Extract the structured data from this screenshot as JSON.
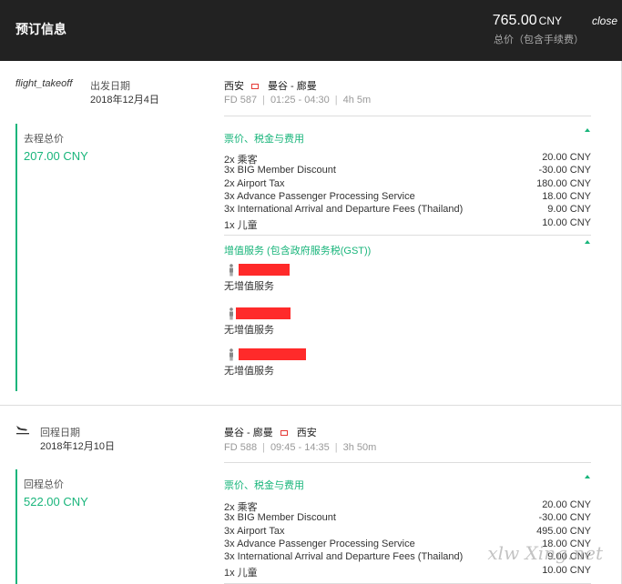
{
  "header": {
    "title": "预订信息",
    "total_amount": "765.00",
    "total_currency": "CNY",
    "close_label": "close",
    "total_note": "总价（包含手续费）"
  },
  "outbound": {
    "icon_text": "flight_takeoff",
    "label": "出发日期",
    "date": "2018年12月4日",
    "route_from": "西安",
    "route_to": "曼谷 - 廊曼",
    "flight_no": "FD 587",
    "time": "01:25 - 04:30",
    "duration": "4h 5m",
    "total_label": "去程总价",
    "total_amount": "207.00 CNY",
    "fees_title": "票价、税金与费用",
    "fees": [
      {
        "desc": "2x 乘客",
        "value": "20.00 CNY"
      },
      {
        "desc": "3x BIG Member Discount",
        "value": "-30.00 CNY"
      },
      {
        "desc": "2x Airport Tax",
        "value": "180.00 CNY"
      },
      {
        "desc": "3x Advance Passenger Processing Service",
        "value": "18.00 CNY"
      },
      {
        "desc": "3x International Arrival and Departure Fees (Thailand)",
        "value": "9.00 CNY"
      },
      {
        "desc": "1x 儿童",
        "value": "10.00 CNY"
      }
    ],
    "services_title": "增值服务 (包含政府服务税(GST))",
    "passengers": [
      {
        "service": "无增值服务"
      },
      {
        "service": "无增值服务"
      },
      {
        "service": "无增值服务"
      }
    ]
  },
  "return": {
    "label": "回程日期",
    "date": "2018年12月10日",
    "route_from": "曼谷 - 廊曼",
    "route_to": "西安",
    "flight_no": "FD 588",
    "time": "09:45 - 14:35",
    "duration": "3h 50m",
    "total_label": "回程总价",
    "total_amount": "522.00 CNY",
    "fees_title": "票价、税金与费用",
    "fees": [
      {
        "desc": "2x 乘客",
        "value": "20.00 CNY"
      },
      {
        "desc": "3x BIG Member Discount",
        "value": "-30.00 CNY"
      },
      {
        "desc": "3x Airport Tax",
        "value": "495.00 CNY"
      },
      {
        "desc": "3x Advance Passenger Processing Service",
        "value": "18.00 CNY"
      },
      {
        "desc": "3x International Arrival and Departure Fees (Thailand)",
        "value": "9.00 CNY"
      },
      {
        "desc": "1x 儿童",
        "value": "10.00 CNY"
      }
    ]
  },
  "watermark": "xlw Xing.net",
  "colors": {
    "accent": "#19b57b",
    "header_bg": "#222222",
    "redaction": "#ff2a2a"
  }
}
